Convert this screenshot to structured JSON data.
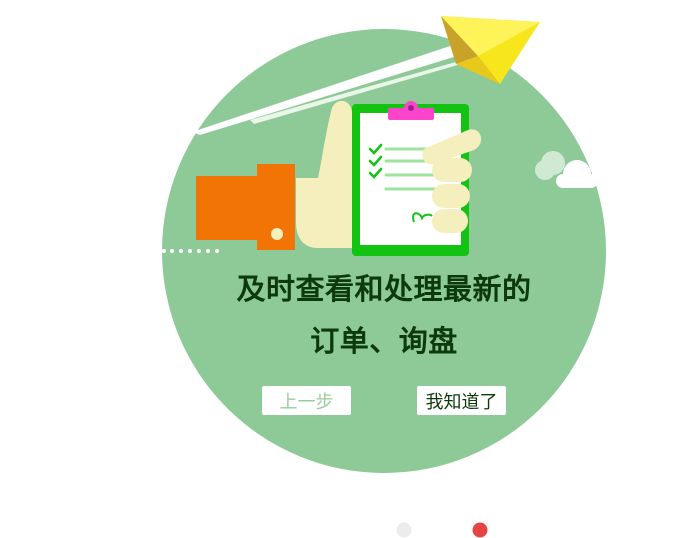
{
  "headline": {
    "line1": "及时查看和处理最新的",
    "line2": "订单、询盘"
  },
  "buttons": {
    "prev_label": "上一步",
    "ok_label": "我知道了"
  },
  "pager": {
    "total": 2,
    "active_index": 2
  },
  "colors": {
    "circle": "#8dca98",
    "headline": "#0d3a0d",
    "clipboard": "#12c312",
    "sleeve": "#f27405",
    "hand": "#f5efbd",
    "clip": "#ff44cc",
    "plane": "#f3e20b",
    "dot_inactive": "#ececec",
    "dot_active": "#e64343"
  },
  "icons": [
    "paper-plane-icon",
    "clipboard-icon",
    "thumbs-up-hand-icon",
    "cloud-icon",
    "checkmark-icon"
  ]
}
